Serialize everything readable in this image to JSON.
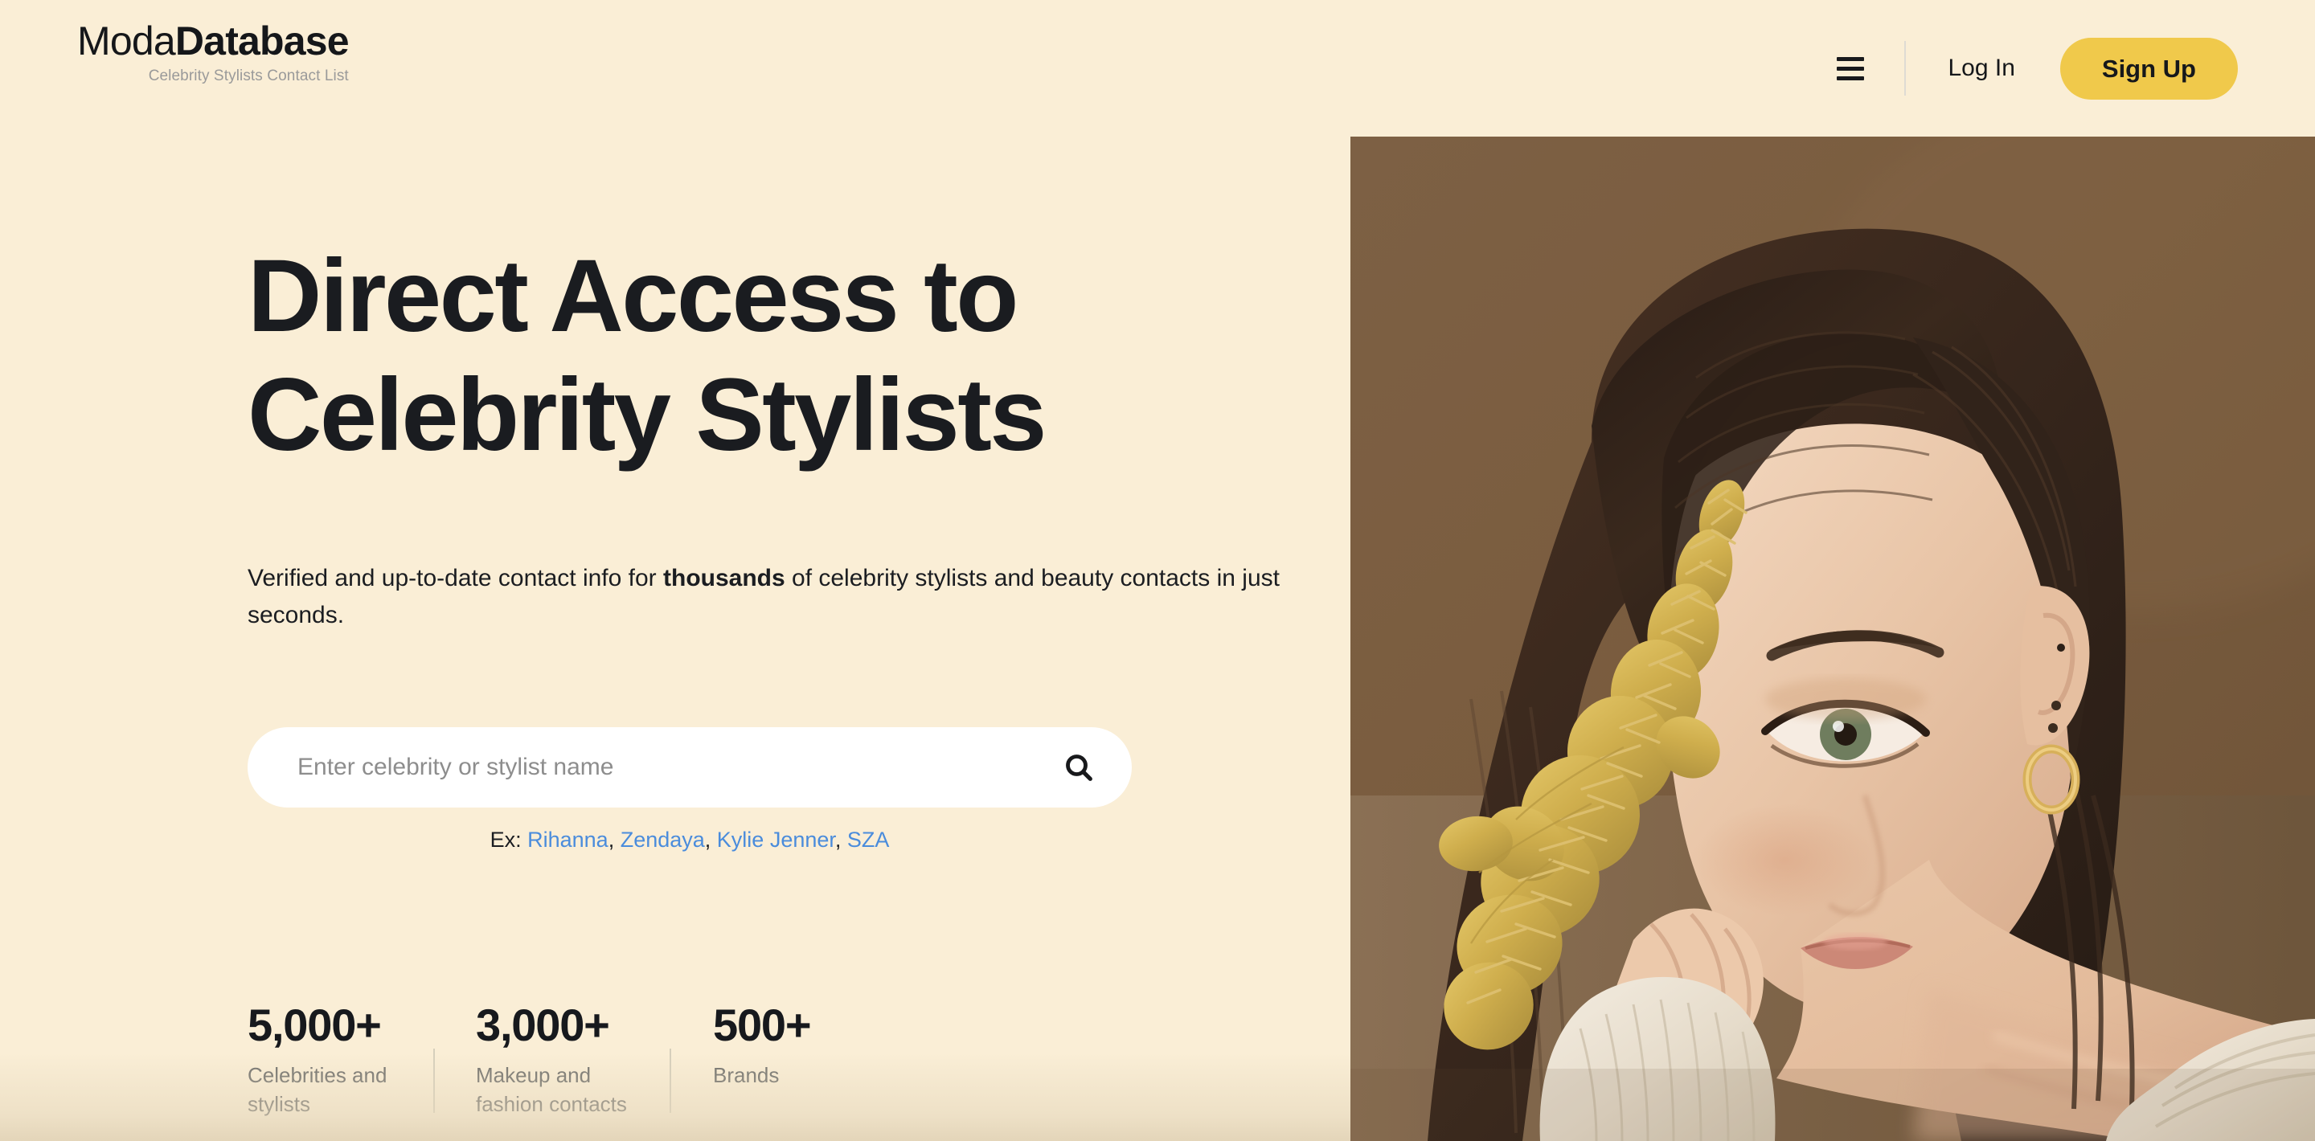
{
  "header": {
    "logo": {
      "part_light": "Moda",
      "part_bold": "Database",
      "tagline": "Celebrity Stylists Contact List"
    },
    "menu_icon": "hamburger-menu-icon",
    "login_label": "Log In",
    "signup_label": "Sign Up"
  },
  "hero": {
    "heading": "Direct Access to\nCelebrity Stylists",
    "subheading_before": "Verified and up-to-date contact info for ",
    "subheading_bold": "thousands",
    "subheading_after": " of celebrity stylists and beauty contacts in just seconds.",
    "search": {
      "placeholder": "Enter celebrity or stylist name",
      "value": "",
      "button_icon": "search-icon"
    },
    "examples": {
      "label": "Ex:",
      "links": [
        "Rihanna",
        "Zendaya",
        "Kylie Jenner",
        "SZA"
      ],
      "separator": ", "
    },
    "stats": [
      {
        "value": "5,000+",
        "label": "Celebrities and stylists"
      },
      {
        "value": "3,000+",
        "label": "Makeup and fashion contacts"
      },
      {
        "value": "500+",
        "label": "Brands"
      }
    ],
    "image_alt": "Woman with dark hair holding dried golden flowers over half her face against a brown backdrop"
  },
  "colors": {
    "background_cream": "#faeed6",
    "accent_yellow": "#f0c94b",
    "text_dark": "#1a1c20",
    "link_blue": "#4a8cdc",
    "muted_gray": "#6f6f6c",
    "image_backdrop_brown": "#7a5e3f"
  }
}
